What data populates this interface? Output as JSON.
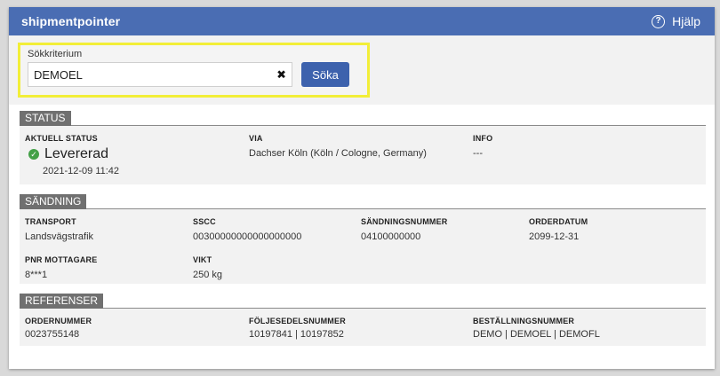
{
  "header": {
    "brand": "shipmentpointer",
    "help_label": "Hjälp"
  },
  "search": {
    "label": "Sökkriterium",
    "value": "DEMOEL",
    "clear_symbol": "✖",
    "button_label": "Söka"
  },
  "status": {
    "title": "STATUS",
    "current_label": "AKTUELL STATUS",
    "current_value": "Levererad",
    "current_date": "2021-12-09 11:42",
    "via_label": "VIA",
    "via_value": "Dachser Köln (Köln / Cologne, Germany)",
    "info_label": "INFO",
    "info_value": "---"
  },
  "shipment": {
    "title": "SÄNDNING",
    "fields": [
      {
        "label": "TRANSPORT",
        "value": "Landsvägstrafik"
      },
      {
        "label": "SSCC",
        "value": "00300000000000000000"
      },
      {
        "label": "SÄNDNINGSNUMMER",
        "value": "04100000000"
      },
      {
        "label": "ORDERDATUM",
        "value": "2099-12-31"
      },
      {
        "label": "PNR MOTTAGARE",
        "value": "8***1"
      },
      {
        "label": "VIKT",
        "value": "250 kg"
      }
    ]
  },
  "references": {
    "title": "REFERENSER",
    "fields": [
      {
        "label": "ORDERNUMMER",
        "value": "0023755148"
      },
      {
        "label": "FÖLJESEDELSNUMMER",
        "value": "10197841 | 10197852"
      },
      {
        "label": "BESTÄLLNINGSNUMMER",
        "value": "DEMO | DEMOEL | DEMOFL"
      }
    ]
  },
  "colors": {
    "header": "#4a6db3",
    "button": "#3d62ad",
    "highlight": "#f2ee38",
    "section_tab": "#707070",
    "status_ok": "#43a047"
  },
  "icons": {
    "help": "question-circle-icon",
    "status": "check-circle-icon",
    "clear": "close-icon"
  }
}
